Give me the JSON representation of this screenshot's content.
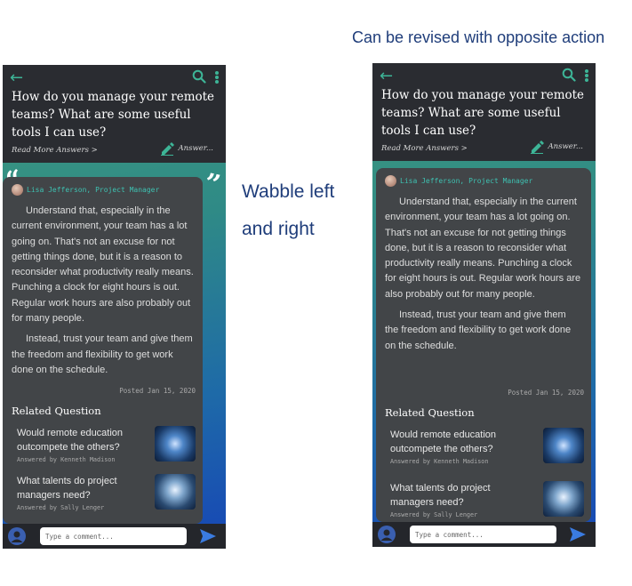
{
  "captions": {
    "top": "Can be revised with opposite action",
    "side_line1": "Wabble left",
    "side_line2": "and right"
  },
  "question": {
    "title": "How do you manage your remote teams? What are some useful tools I can use?",
    "read_more": "Read More Answers >",
    "answer_label": "Answer..."
  },
  "answer": {
    "author": "Lisa Jefferson, Project Manager",
    "paragraphs": [
      "Understand that, especially in the current environment, your team has a lot going on. That's not an excuse for not getting things done, but it is a reason to reconsider what productivity really means. Punching a clock for eight hours is out. Regular work hours are also probably out for many people.",
      "Instead, trust your team and give them the freedom and flexibility to get work done on the schedule."
    ],
    "posted": "Posted Jan 15, 2020"
  },
  "related": {
    "title": "Related Question",
    "items": [
      {
        "question": "Would remote education outcompete the others?",
        "answered_by": "Answered by Kenneth Madison"
      },
      {
        "question": "What talents do project managers need?",
        "answered_by": "Answered by Sally Lenger"
      }
    ]
  },
  "comment": {
    "placeholder": "Type a comment..."
  },
  "colors": {
    "accent": "#3db597",
    "header_bg": "#2a2c31",
    "card_bg": "#424548",
    "caption": "#1f3d7a",
    "send": "#3a7be0"
  }
}
